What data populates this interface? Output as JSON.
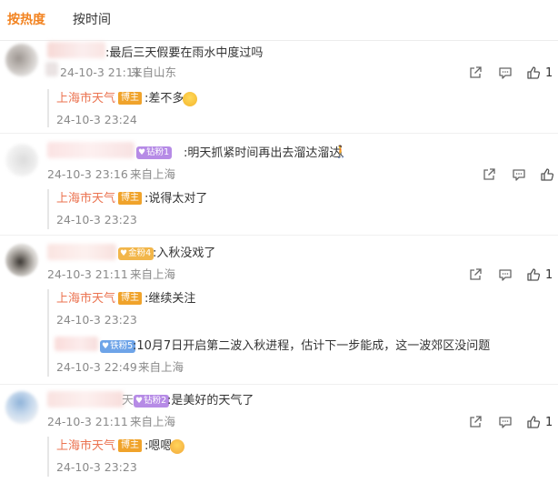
{
  "tabs": [
    {
      "label": "按热度"
    },
    {
      "label": "按时间"
    }
  ],
  "comments": [
    {
      "text": ":最后三天假要在雨水中度过吗",
      "time": "24-10-3 21:11",
      "location": "来自山东",
      "likes": "1",
      "replies": [
        {
          "author": "上海市天气",
          "tag": "博主",
          "text": ":差不多",
          "emoji": "laughing-face",
          "time": "24-10-3 23:24"
        }
      ]
    },
    {
      "fan_badge": "钻粉1",
      "text": ":明天抓紧时间再出去溜达溜达",
      "time": "24-10-3 23:16",
      "location": "来自上海",
      "likes": "",
      "replies": [
        {
          "author": "上海市天气",
          "tag": "博主",
          "text": ":说得太对了",
          "time": "24-10-3 23:23"
        }
      ]
    },
    {
      "fan_badge": "金粉4",
      "text": ":入秋没戏了",
      "time": "24-10-3 21:11",
      "location": "来自上海",
      "likes": "1",
      "replies": [
        {
          "author": "上海市天气",
          "tag": "博主",
          "text": ":继续关注",
          "time": "24-10-3 23:23"
        },
        {
          "fan_badge": "铁粉5",
          "text": ":10月7日开启第二波入秋进程，估计下一步能成，这一波郊区没问题",
          "time": "24-10-3 22:49",
          "location": "来自上海"
        }
      ]
    },
    {
      "name_fragment": "天",
      "fan_badge": "钻粉2",
      "text": ":是美好的天气了",
      "time": "24-10-3 21:11",
      "location": "来自上海",
      "likes": "1",
      "replies": [
        {
          "author": "上海市天气",
          "tag": "博主",
          "text": ":嗯嗯",
          "emoji": "blushing-face",
          "time": "24-10-3 23:23"
        }
      ]
    }
  ],
  "colors": {
    "accent": "#f28320",
    "blogger": "#eb7350",
    "meta": "#8a8a8a"
  }
}
